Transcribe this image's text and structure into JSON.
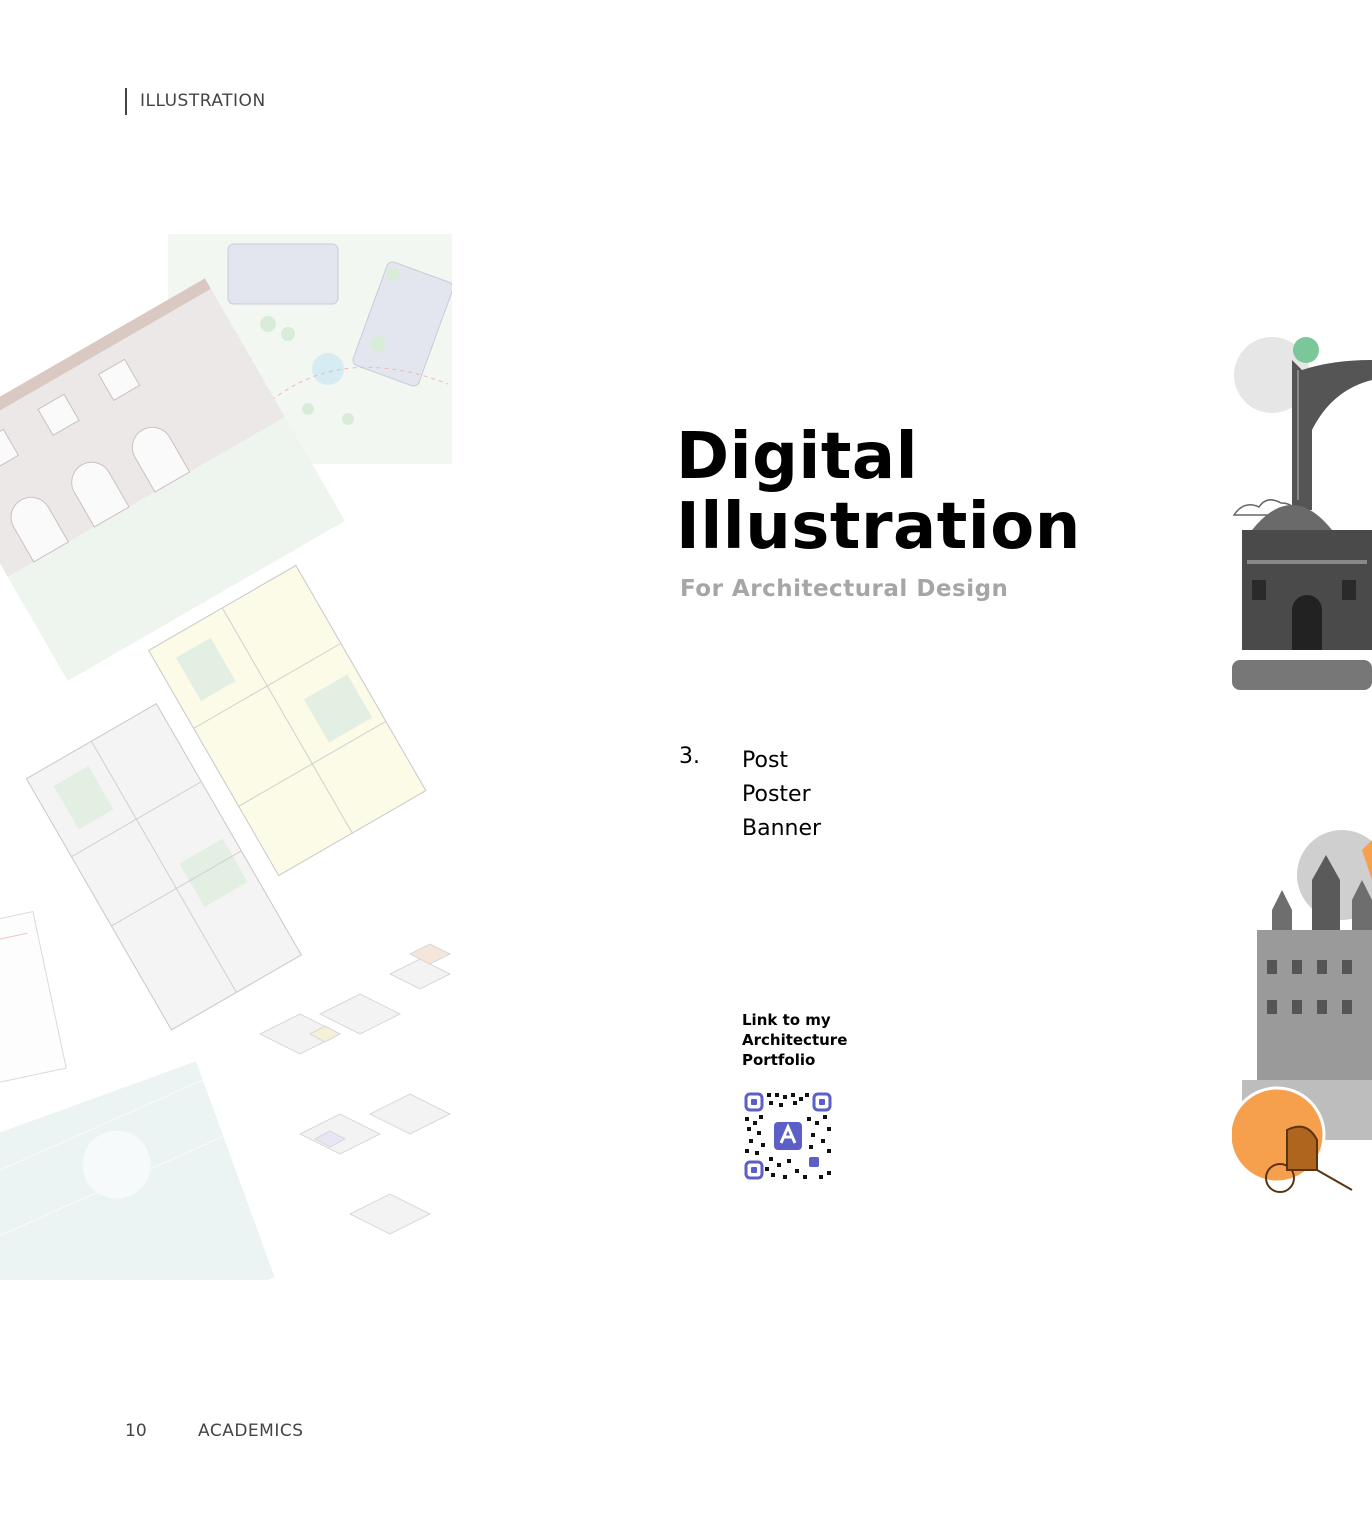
{
  "header": {
    "section": "ILLUSTRATION"
  },
  "title": {
    "line1": "Digital",
    "line2": "Illustration"
  },
  "subtitle": "For Architectural Design",
  "list": {
    "number": "3.",
    "items": [
      "Post",
      "Poster",
      "Banner"
    ]
  },
  "portfolio_link": {
    "line1": "Link to my",
    "line2": "Architecture",
    "line3": "Portfolio"
  },
  "footer": {
    "page_number": "10",
    "section": "ACADEMICS"
  },
  "colors": {
    "accent_green": "#7cc79a",
    "accent_orange": "#f6a04d",
    "qr_purple": "#5b5fc7",
    "subtitle_grey": "#a6a6a6"
  }
}
